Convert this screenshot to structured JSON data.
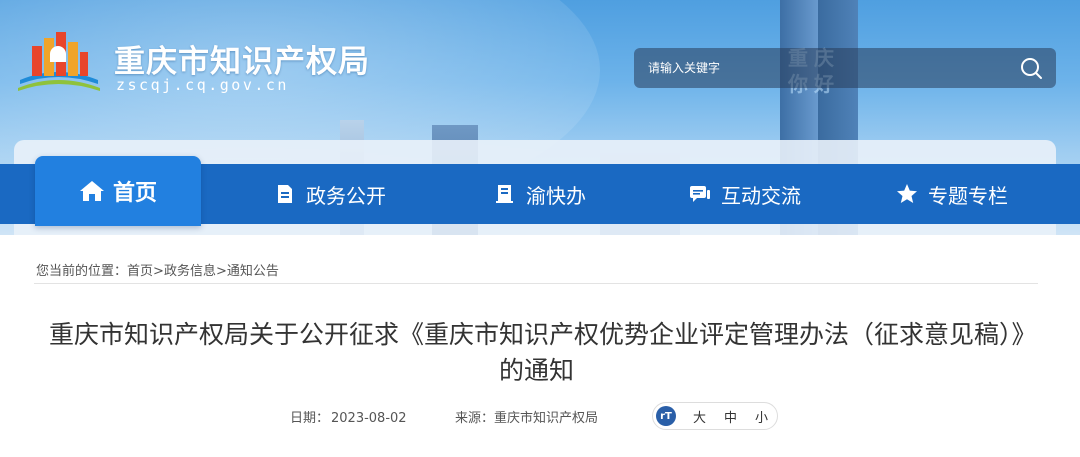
{
  "header": {
    "title": "重庆市知识产权局",
    "domain": "zscqj.cq.gov.cn",
    "tower_text": "重庆你好",
    "search": {
      "placeholder": "请输入关键字"
    }
  },
  "nav": {
    "items": [
      {
        "label": "首页",
        "icon": "home-icon",
        "active": true
      },
      {
        "label": "政务公开",
        "icon": "document-icon"
      },
      {
        "label": "渝快办",
        "icon": "book-icon"
      },
      {
        "label": "互动交流",
        "icon": "chat-icon"
      },
      {
        "label": "专题专栏",
        "icon": "star-icon"
      }
    ]
  },
  "breadcrumb": {
    "prefix": "您当前的位置：",
    "items": [
      "首页",
      "政务信息",
      "通知公告"
    ],
    "separator": ">"
  },
  "article": {
    "title": "重庆市知识产权局关于公开征求《重庆市知识产权优势企业评定管理办法（征求意见稿）》的通知",
    "date_label": "日期：",
    "date": "2023-08-02",
    "source_label": "来源：",
    "source": "重庆市知识产权局"
  },
  "font_size": {
    "icon_text": "rT",
    "options": [
      "大",
      "中",
      "小"
    ]
  },
  "colors": {
    "nav_bg": "#1a69c2",
    "nav_active": "#2280e0",
    "text": "#333333"
  }
}
